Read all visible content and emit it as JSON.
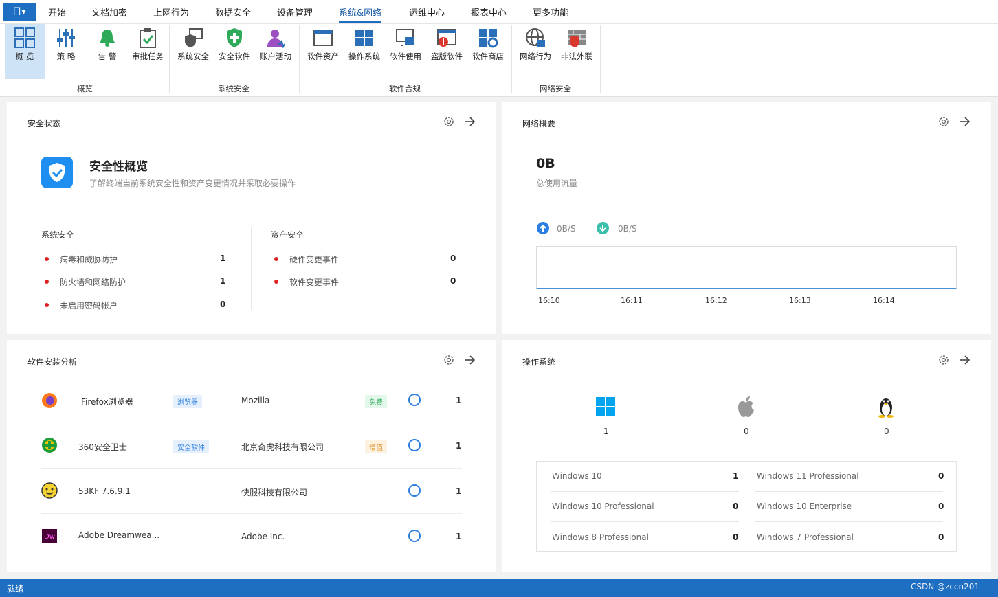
{
  "app_button": "目▾",
  "tabs": [
    "开始",
    "文档加密",
    "上网行为",
    "数据安全",
    "设备管理",
    "系统&网络",
    "运维中心",
    "报表中心",
    "更多功能"
  ],
  "active_tab": "系统&网络",
  "ribbon": {
    "items": [
      "概 览",
      "策 略",
      "告 警",
      "审批任务",
      "系统安全",
      "安全软件",
      "账户活动",
      "软件资产",
      "操作系统",
      "软件使用",
      "盗版软件",
      "软件商店",
      "网络行为",
      "非法外联"
    ],
    "groups": [
      "概览",
      "系统安全",
      "软件合规",
      "网络安全"
    ]
  },
  "security": {
    "title": "安全状态",
    "heading": "安全性概览",
    "desc": "了解终端当前系统安全性和资产变更情况并采取必要操作",
    "sys_title": "系统安全",
    "sys_rows": [
      {
        "label": "病毒和威胁防护",
        "value": "1"
      },
      {
        "label": "防火墙和网络防护",
        "value": "1"
      },
      {
        "label": "未启用密码帐户",
        "value": "0"
      }
    ],
    "asset_title": "资产安全",
    "asset_rows": [
      {
        "label": "硬件变更事件",
        "value": "0"
      },
      {
        "label": "软件变更事件",
        "value": "0"
      }
    ]
  },
  "network": {
    "title": "网络概要",
    "total": "0B",
    "total_label": "总使用流量",
    "up": "0B/S",
    "down": "0B/S",
    "times": [
      "16:10",
      "16:11",
      "16:12",
      "16:13",
      "16:14"
    ]
  },
  "software": {
    "title": "软件安装分析",
    "rows": [
      {
        "name": "Firefox浏览器",
        "cat": "浏览器",
        "vendor": "Mozilla",
        "lic": "免费",
        "count": "1"
      },
      {
        "name": "360安全卫士",
        "cat": "安全软件",
        "vendor": "北京奇虎科技有限公司",
        "lic": "增值",
        "count": "1"
      },
      {
        "name": "53KF 7.6.9.1",
        "cat": "",
        "vendor": "快服科技有限公司",
        "lic": "",
        "count": "1"
      },
      {
        "name": "Adobe Dreamwea...",
        "cat": "",
        "vendor": "Adobe Inc.",
        "lic": "",
        "count": "1"
      }
    ]
  },
  "os": {
    "title": "操作系统",
    "counts": [
      "1",
      "0",
      "0"
    ],
    "rows": [
      {
        "name": "Windows 10",
        "value": "1"
      },
      {
        "name": "Windows 11 Professional",
        "value": "0"
      },
      {
        "name": "Windows 10 Professional",
        "value": "0"
      },
      {
        "name": "Windows 10 Enterprise",
        "value": "0"
      },
      {
        "name": "Windows 8 Professional",
        "value": "0"
      },
      {
        "name": "Windows 7 Professional",
        "value": "0"
      }
    ]
  },
  "status": {
    "left": "就绪",
    "watermark": "CSDN @zccn201"
  },
  "colors": {
    "accent": "#1e6fc1",
    "danger": "#e02020",
    "up": "#2a7de1",
    "down": "#3bbfad"
  }
}
